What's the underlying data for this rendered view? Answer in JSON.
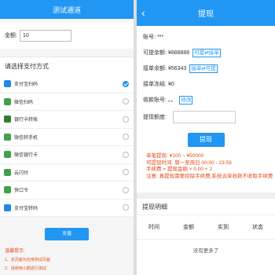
{
  "left": {
    "header_title": "测试通道",
    "amount_label": "金额:",
    "amount_value": "10",
    "section_title": "请选择支付方式",
    "methods": [
      {
        "label": "支付宝扫码",
        "color": "#1e88e5",
        "selected": true,
        "icon": "alipay-icon"
      },
      {
        "label": "微信扫码",
        "color": "#43a047",
        "selected": false,
        "icon": "wechat-icon"
      },
      {
        "label": "银行卡转账",
        "color": "#2e7d32",
        "selected": false,
        "icon": "bank-card-icon"
      },
      {
        "label": "微信转手机",
        "color": "#43a047",
        "selected": false,
        "icon": "wechat-icon"
      },
      {
        "label": "微信银行卡",
        "color": "#43a047",
        "selected": false,
        "icon": "wechat-icon"
      },
      {
        "label": "云闪付",
        "color": "#43a047",
        "selected": false,
        "icon": "cloud-pay-icon"
      },
      {
        "label": "快口令",
        "color": "#43a047",
        "selected": false,
        "icon": "password-icon"
      },
      {
        "label": "支付宝转码",
        "color": "#1e88e5",
        "selected": false,
        "icon": "alipay-icon"
      }
    ],
    "submit_label": "充值",
    "tips_title": "温馨提示:",
    "tips": [
      "1、本页面为应用测试页面",
      "2、请使用小额进行测试"
    ]
  },
  "right": {
    "back_icon": "‹",
    "header_title": "提现",
    "account_label": "账号:",
    "account_value": "***",
    "withdrawable_label": "可提余额:",
    "withdrawable_value": "¥888888",
    "withdrawable_link": "可提⇄接单",
    "order_balance_label": "接单余额:",
    "order_balance_value": "¥56343",
    "order_balance_link": "接单⇄可提",
    "order_frozen_label": "接单冻结:",
    "order_frozen_value": "¥0",
    "collect_label": "收款账号:",
    "collect_value": "。。",
    "collect_link": "修改",
    "amount_label": "提现额度:",
    "submit_label": "提现",
    "notes": [
      "单笔提现: ¥100 ~ ¥50000",
      "可提现时间: 周一至周日 00:00 - 23:59",
      "手续费 = 提现金额 × 0.00 + 2",
      "注意: 真提现需要扣除手续费,系统派单收款不收取手续费"
    ],
    "detail_title": "提现明细",
    "table_headers": [
      "时间",
      "金额",
      "实到",
      "状态"
    ],
    "empty_text": "没有更多了",
    "accent_color": "#2196f3",
    "warn_color": "#e64a19"
  }
}
